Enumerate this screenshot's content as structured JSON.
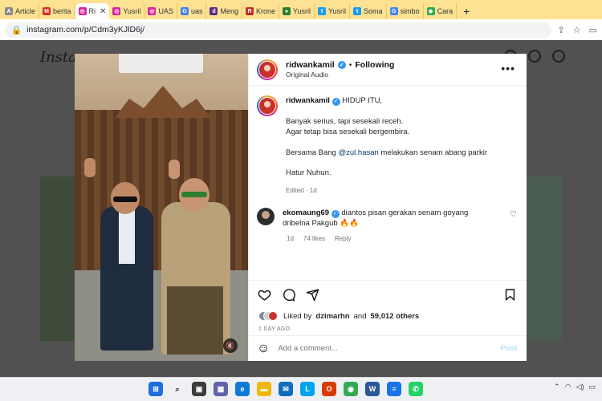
{
  "browser": {
    "tabs": [
      {
        "label": "Article",
        "icon": "article-favicon",
        "color": "#8a8a8a",
        "glyph": "A"
      },
      {
        "label": "berita",
        "icon": "gmail-favicon",
        "color": "#d93025",
        "glyph": "M"
      },
      {
        "label": "Ri",
        "icon": "instagram-favicon",
        "color": "#d6249f",
        "glyph": "◎",
        "active": true
      },
      {
        "label": "Yusril",
        "icon": "instagram-favicon",
        "color": "#d6249f",
        "glyph": "◎"
      },
      {
        "label": "UAS",
        "icon": "instagram-favicon",
        "color": "#d6249f",
        "glyph": "◎"
      },
      {
        "label": "uas",
        "icon": "google-favicon",
        "color": "#4285f4",
        "glyph": "G"
      },
      {
        "label": "Meng",
        "icon": "detik-favicon",
        "color": "#5a2c84",
        "glyph": "d"
      },
      {
        "label": "Krone",
        "icon": "r-favicon",
        "color": "#c62828",
        "glyph": "R"
      },
      {
        "label": "Yusril",
        "icon": "app-favicon",
        "color": "#2e7d32",
        "glyph": "●"
      },
      {
        "label": "Yusril",
        "icon": "twitter-favicon",
        "color": "#1d9bf0",
        "glyph": "t"
      },
      {
        "label": "Soma",
        "icon": "twitter-favicon",
        "color": "#1d9bf0",
        "glyph": "t"
      },
      {
        "label": "simbo",
        "icon": "google-favicon",
        "color": "#4285f4",
        "glyph": "G"
      },
      {
        "label": "Cara",
        "icon": "maps-favicon",
        "color": "#34a853",
        "glyph": "◆"
      }
    ],
    "new_tab": "+",
    "url": "instagram.com/p/Cdm3yKJlD6j/"
  },
  "instagram": {
    "logo": "Instagram"
  },
  "post": {
    "username": "ridwankamil",
    "separator": "•",
    "follow_status": "Following",
    "audio": "Original Audio",
    "caption_title": "HIDUP ITU,",
    "caption_lines_1": [
      "Banyak serius, tapi sesekali receh.",
      "Agar tetap bisa sesekali bergembira."
    ],
    "caption_p2_before": "Bersama Bang ",
    "caption_mention": "@zul.hasan",
    "caption_p2_after": " melakukan senam abang parkir",
    "caption_p3": "Hatur Nuhun.",
    "caption_meta": "Edited · 1d",
    "comment": {
      "username": "ekomaung69",
      "text": "diantos pisan gerakan senam goyang dribelna Pakgub 🔥🔥",
      "age": "1d",
      "likes": "74 likes",
      "reply": "Reply"
    },
    "liked_by_prefix": "Liked by ",
    "liked_by_user": "dzimarhn",
    "liked_by_mid": " and ",
    "liked_by_count": "59,012 others",
    "time_ago": "1 DAY AGO",
    "add_comment_placeholder": "Add a comment...",
    "post_button": "Post"
  }
}
